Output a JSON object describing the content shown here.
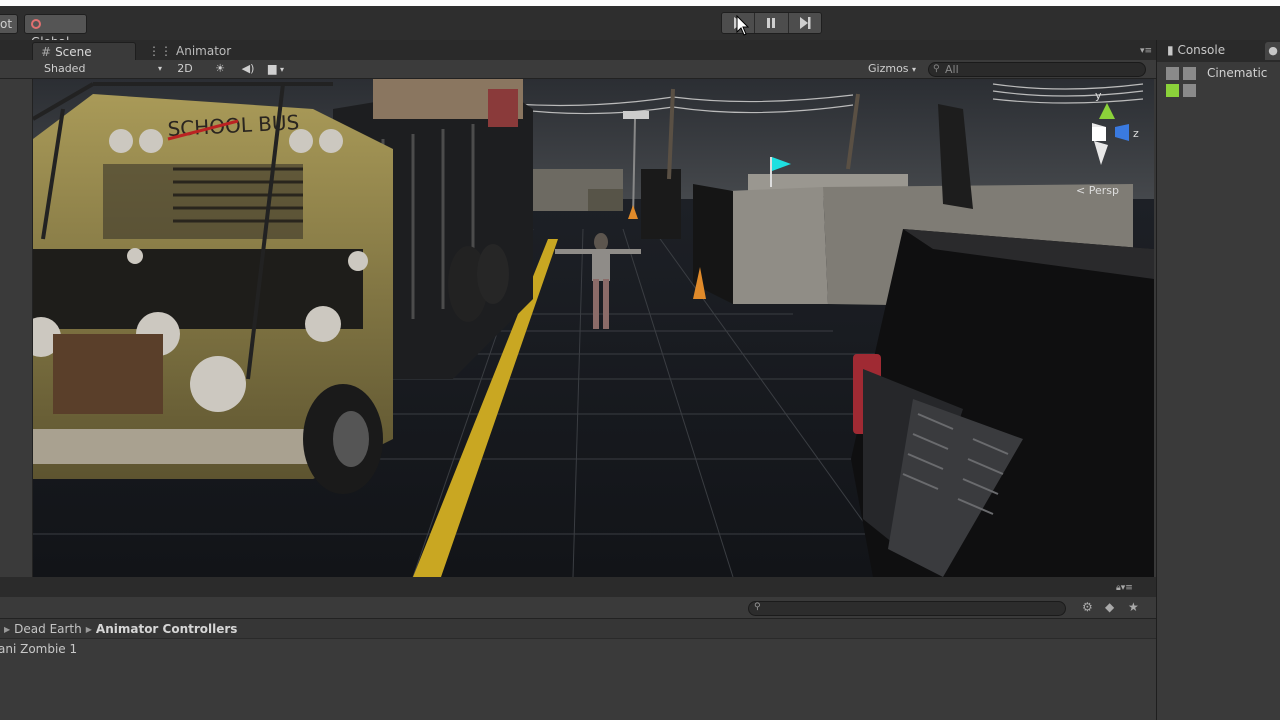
{
  "toolbar": {
    "pivot_label": "ot",
    "global_label": "Global",
    "play_icon": "play-icon",
    "pause_icon": "pause-icon",
    "step_icon": "step-icon"
  },
  "tabs": {
    "scene": "Scene",
    "animator": "Animator",
    "console": "Console"
  },
  "scene_toolbar": {
    "draw_mode": "Shaded",
    "mode_2d": "2D",
    "gizmos": "Gizmos",
    "search_placeholder": "All"
  },
  "viewport": {
    "projection": "Persp",
    "gizmo_labels": {
      "y": "y",
      "z": "z"
    },
    "bus_text": "SCHOOL BUS"
  },
  "inspector": {
    "item_label": "Cinematic"
  },
  "project": {
    "breadcrumb": [
      "Dead Earth",
      "Animator Controllers"
    ],
    "asset": "ani Zombie 1"
  },
  "colors": {
    "panel": "#383838",
    "tab_bar": "#2a2a2a",
    "accent_flag": "#1ee0e0",
    "road_line": "#c9a722"
  }
}
